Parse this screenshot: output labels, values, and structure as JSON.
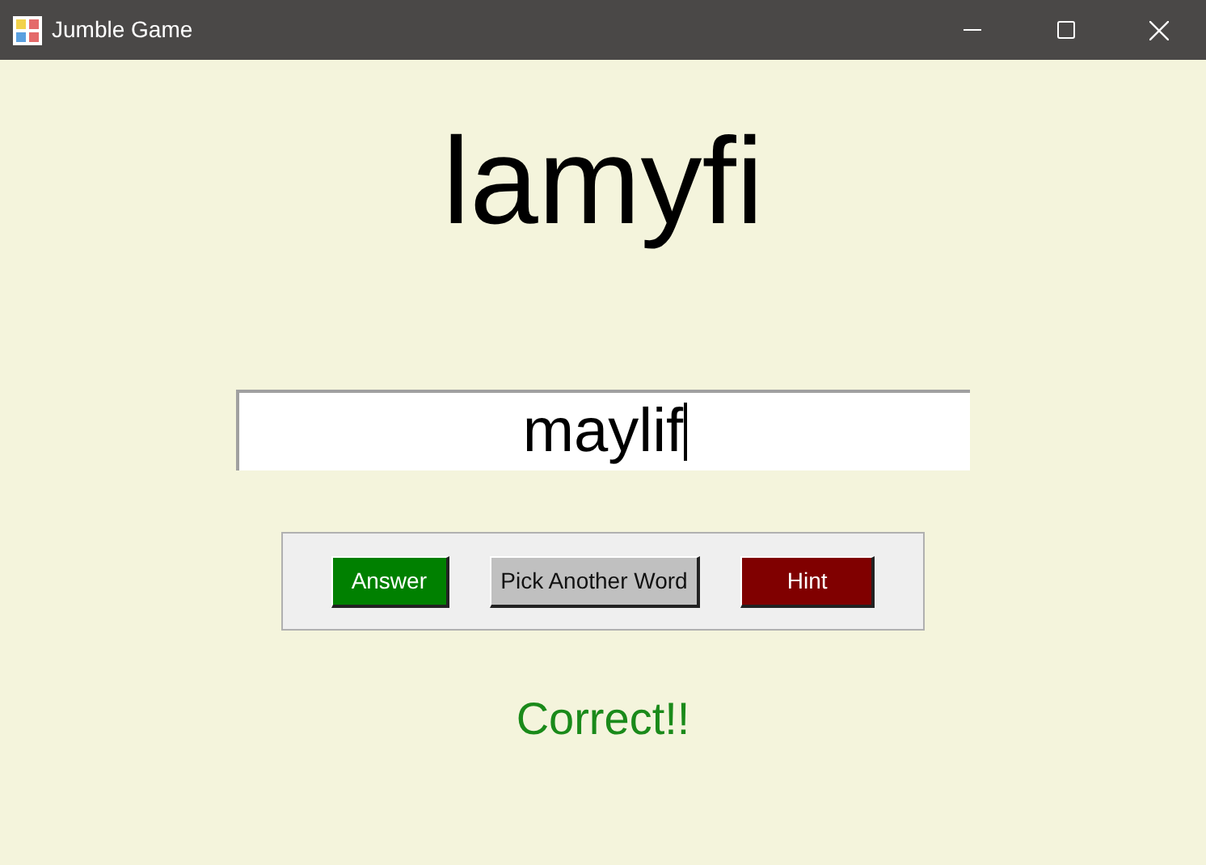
{
  "window": {
    "title": "Jumble Game"
  },
  "jumbled_word": "lamyfi",
  "answer_field": {
    "value": "maylif"
  },
  "buttons": [
    {
      "label": "Answer",
      "color": "#008000"
    },
    {
      "label": "Pick Another Word",
      "color": "#c0c0c0"
    },
    {
      "label": "Hint",
      "color": "#800000"
    }
  ],
  "result": "Correct!!"
}
